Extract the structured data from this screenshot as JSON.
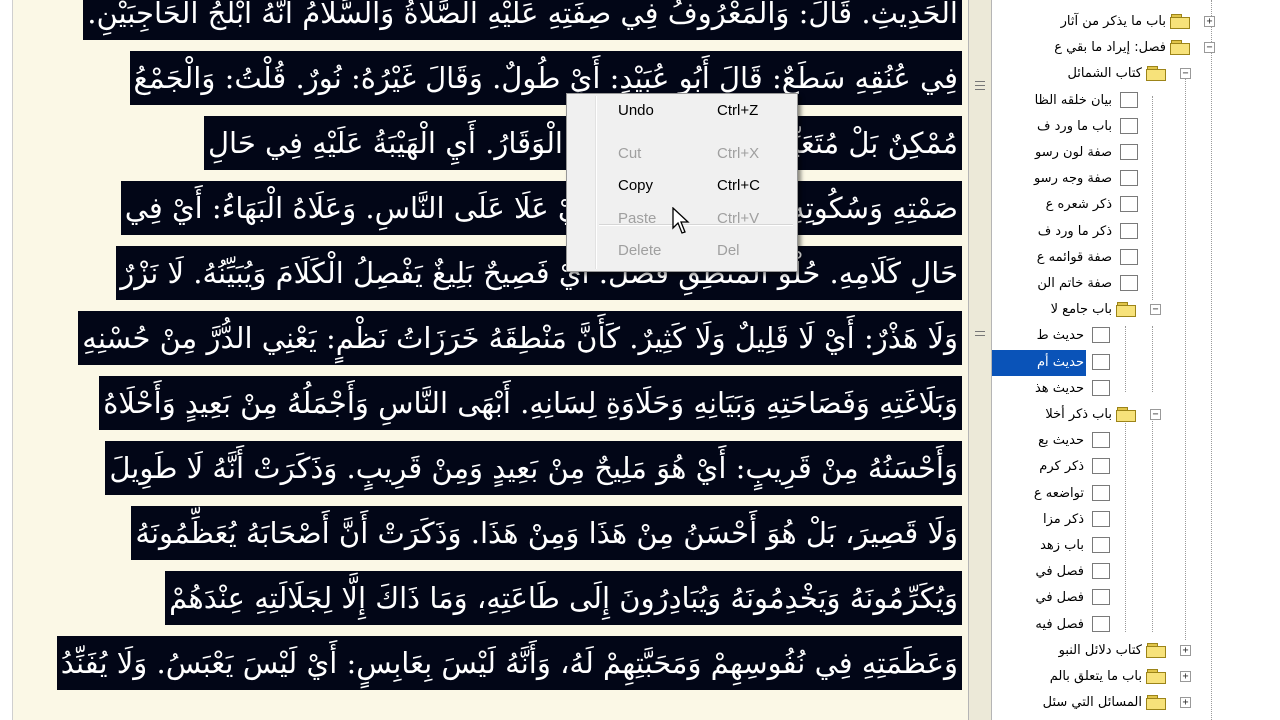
{
  "text_lines": [
    "الْحَدِيثِ. قَالَ: وَالْمَعْرُوفُ فِي صِفَتِهِ عَلَيْهِ الصَّلَاةُ وَالسَّلَامُ أَنَّهُ أَبْلَجُ الْحَاجِبَيْنِ.",
    "فِي عُنُقِهِ سَطَعٌ: قَالَ أَبُو عُبَيْدٍ: أَيْ طُولٌ. وَقَالَ غَيْرُهُ: نُورٌ. قُلْتُ: وَالْجَمْعُ",
    "مُمْكِنٌ بَلْ مُتَعَيِّنٌ. إِنْ صَمَتَ فَعَلَيْهِ الْوَقَارُ. أَيِ الْهَيْبَةُ عَلَيْهِ فِي حَالِ",
    "صَمْتِهِ وَسُكُوتِهِ. وَإِنْ تَكَلَّمَ سَمَا. أَيْ عَلَا عَلَى النَّاسِ. وَعَلَاهُ الْبَهَاءُ: أَيْ فِي",
    "حَالِ كَلَامِهِ. حُلْوُ الْمَنْطِقِ فَصْلٌ. أَيْ فَصِيحٌ بَلِيغٌ يَفْصِلُ الْكَلَامَ وَيُبَيِّنُهُ. لَا نَزْرٌ",
    "وَلَا هَذْرٌ: أَيْ لَا قَلِيلٌ وَلَا كَثِيرٌ. كَأَنَّ مَنْطِقَهُ خَرَزَاتُ نَظْمٍ: يَعْنِي الدُّرَّ مِنْ حُسْنِهِ",
    "وَبَلَاغَتِهِ وَفَصَاحَتِهِ وَبَيَانِهِ وَحَلَاوَةِ لِسَانِهِ. أَبْهَى النَّاسِ وَأَجْمَلُهُ مِنْ بَعِيدٍ وَأَحْلَاهُ",
    "وَأَحْسَنُهُ مِنْ قَرِيبٍ: أَيْ هُوَ مَلِيحٌ مِنْ بَعِيدٍ وَمِنْ قَرِيبٍ. وَذَكَرَتْ أَنَّهُ لَا طَوِيلَ",
    "وَلَا قَصِيرَ، بَلْ هُوَ أَحْسَنُ مِنْ هَذَا وَمِنْ هَذَا. وَذَكَرَتْ أَنَّ أَصْحَابَهُ يُعَظِّمُونَهُ",
    "وَيُكَرِّمُونَهُ وَيَخْدِمُونَهُ وَيُبَادِرُونَ إِلَى طَاعَتِهِ، وَمَا ذَاكَ إِلَّا لِجَلَالَتِهِ عِنْدَهُمْ",
    "وَعَظَمَتِهِ فِي نُفُوسِهِمْ وَمَحَبَّتِهِمْ لَهُ، وَأَنَّهُ لَيْسَ بِعَابِسٍ: أَيْ لَيْسَ يَعْبَسُ. وَلَا يُفَنِّدُ"
  ],
  "context_menu": {
    "items": [
      {
        "label": "Undo",
        "shortcut": "Ctrl+Z",
        "enabled": true
      },
      {
        "label": "Cut",
        "shortcut": "Ctrl+X",
        "enabled": false
      },
      {
        "label": "Copy",
        "shortcut": "Ctrl+C",
        "enabled": true
      },
      {
        "label": "Paste",
        "shortcut": "Ctrl+V",
        "enabled": false
      },
      {
        "label": "Delete",
        "shortcut": "Del",
        "enabled": false
      }
    ]
  },
  "tree": {
    "nodes": [
      {
        "label": "باب ما يذكر من آثار",
        "icon": "folder-icon",
        "toggle": "+"
      },
      {
        "label": "فصل: إيراد ما بقي ع",
        "icon": "folder-icon",
        "toggle": "−"
      },
      {
        "label": "كتاب الشمائل",
        "icon": "folder-icon",
        "toggle": "−"
      },
      {
        "label": "بيان خلقه الظا",
        "icon": "page-icon"
      },
      {
        "label": "باب ما ورد ف",
        "icon": "page-icon"
      },
      {
        "label": "صفة لون رسو",
        "icon": "page-icon"
      },
      {
        "label": "صفة وجه رسو",
        "icon": "page-icon"
      },
      {
        "label": "ذكر شعره ع",
        "icon": "page-icon"
      },
      {
        "label": "ذكر ما ورد ف",
        "icon": "page-icon"
      },
      {
        "label": "صفة قوائمه ع",
        "icon": "page-icon"
      },
      {
        "label": "صفة خاتم الن",
        "icon": "page-icon"
      },
      {
        "label": "باب جامع لا",
        "icon": "folder-icon",
        "toggle": "−"
      },
      {
        "label": "حديث ط",
        "icon": "page-icon"
      },
      {
        "label": "حديث أم",
        "icon": "page-icon",
        "selected": true
      },
      {
        "label": "حديث هذ",
        "icon": "page-icon"
      },
      {
        "label": "باب ذكر أخلا",
        "icon": "folder-icon",
        "toggle": "−"
      },
      {
        "label": "حديث بع",
        "icon": "page-icon"
      },
      {
        "label": "ذكر كرم",
        "icon": "page-icon"
      },
      {
        "label": "تواضعه ع",
        "icon": "page-icon"
      },
      {
        "label": "ذكر مزا",
        "icon": "page-icon"
      },
      {
        "label": "باب زهد",
        "icon": "page-icon"
      },
      {
        "label": "فصل في",
        "icon": "page-icon"
      },
      {
        "label": "فصل في",
        "icon": "page-icon"
      },
      {
        "label": "فصل فيه",
        "icon": "page-icon"
      },
      {
        "label": "كتاب دلائل النبو",
        "icon": "folder-icon",
        "toggle": "+"
      },
      {
        "label": "باب ما يتعلق بالم",
        "icon": "folder-icon",
        "toggle": "+"
      },
      {
        "label": "المسائل التي سئل",
        "icon": "folder-icon",
        "toggle": "+"
      }
    ]
  },
  "colors": {
    "text_highlight": "#020617",
    "page": "#fbf8e6",
    "selection": "#0a53b8"
  }
}
